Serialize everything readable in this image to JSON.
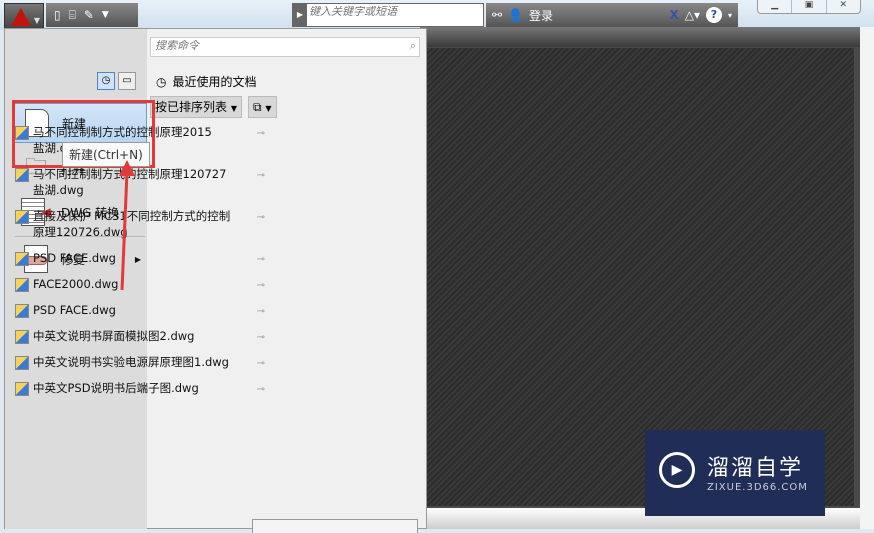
{
  "toolbar": {
    "search_placeholder": "键入关键字或短语",
    "login": "登录"
  },
  "menu": {
    "search_placeholder": "搜索命令",
    "items": [
      {
        "label": "新建"
      },
      {
        "label": "打开"
      },
      {
        "label": "DWG 转换"
      },
      {
        "label": "修复"
      }
    ],
    "tooltip": "新建(Ctrl+N)",
    "recent_title": "最近使用的文档",
    "sort_label": "按已排序列表",
    "files": [
      "马不同控制制方式的控制原理2015盐湖.dwg",
      "马不同控制制方式的控制原理120727盐湖.dwg",
      "直接及保护 MC31不同控制方式的控制原理120726.dwg",
      "PSD FACE.dwg",
      "FACE2000.dwg",
      "PSD FACE.dwg",
      "中英文说明书屏面模拟图2.dwg",
      "中英文说明书实验电源屏原理图1.dwg",
      "中英文PSD说明书后端子图.dwg"
    ]
  },
  "watermark": {
    "title": "溜溜自学",
    "url": "ZIXUE.3D66.COM"
  }
}
